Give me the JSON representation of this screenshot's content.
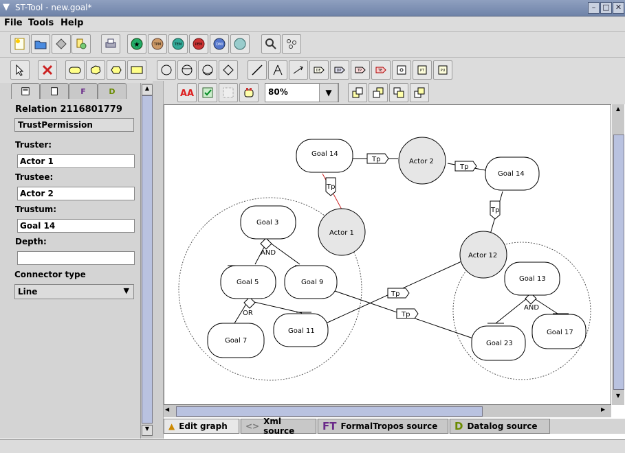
{
  "window": {
    "title": "ST-Tool - new.goal*"
  },
  "menu": [
    "File",
    "Tools",
    "Help"
  ],
  "panel": {
    "relation": "Relation 2116801779",
    "type": "TrustPermission",
    "truster_label": "Truster:",
    "truster": "Actor 1",
    "trustee_label": "Trustee:",
    "trustee": "Actor 2",
    "trustum_label": "Trustum:",
    "trustum": "Goal 14",
    "depth_label": "Depth:",
    "depth": "",
    "connector_label": "Connector type",
    "connector": "Line"
  },
  "graph_toolbar": {
    "zoom": "80%"
  },
  "bottom_tabs": [
    "Edit graph",
    "Xml source",
    "FormalTropos source",
    "Datalog source"
  ],
  "graph": {
    "actors": [
      "Actor 2",
      "Actor 1",
      "Actor 12"
    ],
    "goals": [
      "Goal 14",
      "Goal 14",
      "Goal 3",
      "Goal 5",
      "Goal 9",
      "Goal 7",
      "Goal 11",
      "Goal 13",
      "Goal 23",
      "Goal 17"
    ],
    "tp_label": "Tp",
    "and_label": "AND",
    "or_label": "OR"
  },
  "colors": {
    "title_bar": "#7b8db0",
    "accent_red": "#cc2222",
    "scroll_thumb": "#b9c2e0"
  }
}
